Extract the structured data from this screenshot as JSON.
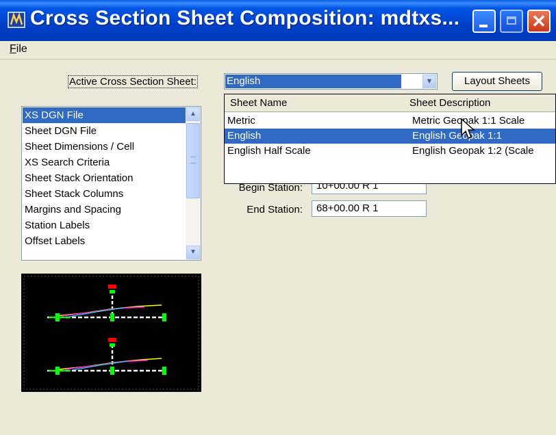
{
  "window": {
    "title": "Cross Section Sheet Composition: mdtxs...",
    "icon": "microstation-icon",
    "controls": [
      "minimize-icon",
      "maximize-icon",
      "close-icon"
    ]
  },
  "menu": {
    "file": "File"
  },
  "active_sheet": {
    "label": "Active Cross Section Sheet:",
    "value": "English",
    "layout_button": "Layout Sheets"
  },
  "dropdown": {
    "headers": {
      "name": "Sheet Name",
      "description": "Sheet Description"
    },
    "rows": [
      {
        "name": "Metric",
        "description": "Metric Geopak 1:1 Scale",
        "selected": false
      },
      {
        "name": "English",
        "description": "English Geopak 1:1",
        "selected": true
      },
      {
        "name": "English Half Scale",
        "description": "English Geopak 1:2 (Scale",
        "selected": false
      }
    ]
  },
  "stations": {
    "begin_label": "Begin Station:",
    "begin_value": "10+00.00 R 1",
    "end_label": "End Station:",
    "end_value": "68+00.00 R 1"
  },
  "options_list": {
    "items": [
      "XS DGN File",
      "Sheet DGN File",
      "Sheet Dimensions / Cell",
      "XS Search Criteria",
      "Sheet Stack Orientation",
      "Sheet Stack Columns",
      "Margins and Spacing",
      "Station Labels",
      "Offset Labels"
    ],
    "selected_index": 0
  },
  "colors": {
    "selection": "#316ac5",
    "titlebar": "#0055e5",
    "preview_bg": "#000000"
  }
}
